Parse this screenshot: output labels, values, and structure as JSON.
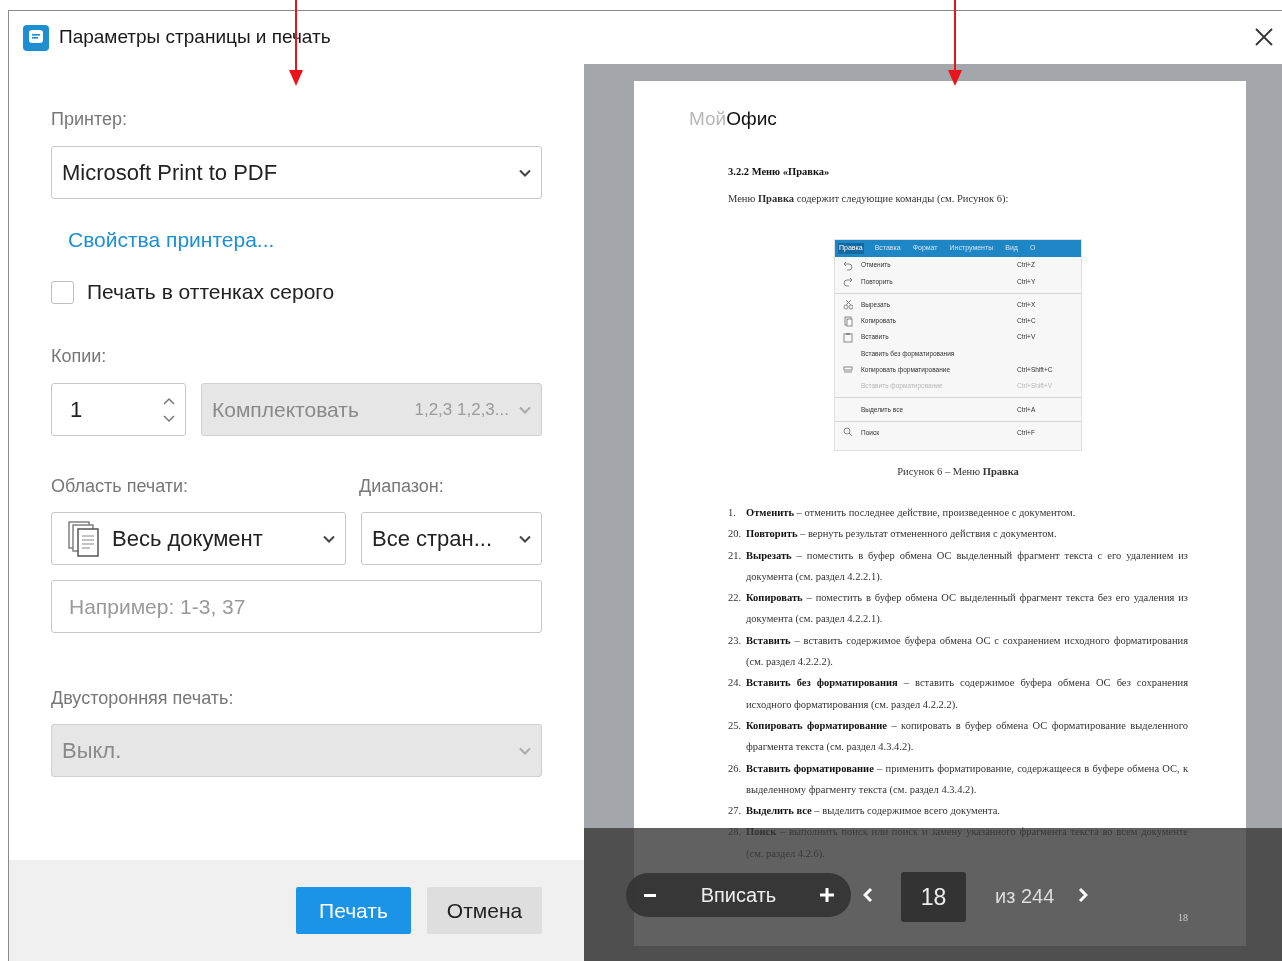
{
  "window": {
    "title": "Параметры страницы и печать"
  },
  "printer": {
    "label": "Принтер:",
    "value": "Microsoft Print to PDF"
  },
  "printer_properties_link": "Свойства принтера...",
  "grayscale": {
    "label": "Печать в оттенках серого",
    "checked": false
  },
  "copies": {
    "label": "Копии:",
    "value": "1"
  },
  "collate": {
    "value": "Комплектовать",
    "hint": "1,2,3 1,2,3...",
    "disabled": true
  },
  "print_area": {
    "label": "Область печати:",
    "value": "Весь документ"
  },
  "range": {
    "label": "Диапазон:",
    "value": "Все стран..."
  },
  "pages_field": {
    "placeholder": "Например: 1-3, 37"
  },
  "duplex": {
    "label": "Двусторонняя печать:",
    "value": "Выкл.",
    "disabled": true
  },
  "buttons": [
    {
      "label": "Печать",
      "kind": "primary"
    },
    {
      "label": "Отмена",
      "kind": "secondary"
    }
  ],
  "preview": {
    "document": {
      "logo": "Мой**Офис**",
      "heading": "3.2.2 Меню «Правка»",
      "intro": "Меню **Правка** содержит следующие команды (см. Рисунок 6):",
      "figure": {
        "menu_bar": [
          {
            "label": "Правка",
            "selected": true
          },
          {
            "label": "Вставка",
            "selected": false
          },
          {
            "label": "Формат",
            "selected": false
          },
          {
            "label": "Инструменты",
            "selected": false
          },
          {
            "label": "Вид",
            "selected": false
          },
          {
            "label": "О",
            "selected": false
          }
        ],
        "items": [
          {
            "label": "Отменить",
            "shortcut": "Ctrl+Z",
            "disabled": false,
            "divider_before": false
          },
          {
            "label": "Повторить",
            "shortcut": "Ctrl+Y",
            "disabled": false,
            "divider_before": false
          },
          {
            "label": "Вырезать",
            "shortcut": "Ctrl+X",
            "disabled": false,
            "divider_before": true
          },
          {
            "label": "Копировать",
            "shortcut": "Ctrl+C",
            "disabled": false,
            "divider_before": false
          },
          {
            "label": "Вставить",
            "shortcut": "Ctrl+V",
            "disabled": false,
            "divider_before": false
          },
          {
            "label": "Вставить без форматирования",
            "disabled": false,
            "divider_before": false
          },
          {
            "label": "Копировать форматирование",
            "shortcut": "Ctrl+Shift+C",
            "disabled": false,
            "divider_before": false
          },
          {
            "label": "Вставить форматирование",
            "shortcut": "Ctrl+Shift+V",
            "disabled": true,
            "divider_before": false
          },
          {
            "label": "Выделить все",
            "shortcut": "Ctrl+A",
            "disabled": false,
            "divider_before": true
          },
          {
            "label": "Поиск",
            "shortcut": "Ctrl+F",
            "disabled": false,
            "divider_before": true
          }
        ],
        "caption": "Рисунок 6 – Меню **Правка**"
      },
      "list": [
        {
          "number": "1.",
          "text": "**Отменить** – отменить последнее действие, произведенное с документом."
        },
        {
          "number": "20.",
          "text": "**Повторить** – вернуть результат отмененного действия с документом."
        },
        {
          "number": "21.",
          "text": "**Вырезать** – поместить в буфер обмена ОС выделенный фрагмент текста с его удалением из документа (см. раздел 4.2.2.1)."
        },
        {
          "number": "22.",
          "text": "**Копировать** – поместить в буфер обмена ОС выделенный фрагмент текста без его удаления из документа (см. раздел 4.2.2.1)."
        },
        {
          "number": "23.",
          "text": "**Вставить** – вставить содержимое буфера обмена ОС с сохранением исходного форматирования (см. раздел 4.2.2.2)."
        },
        {
          "number": "24.",
          "text": "**Вставить без форматирования** – вставить содержимое буфера обмена ОС без сохранения исходного форматирования (см. раздел 4.2.2.2)."
        },
        {
          "number": "25.",
          "text": "**Копировать форматирование** – копировать в буфер обмена ОС форматирование выделенного фрагмента текста (см. раздел 4.3.4.2)."
        },
        {
          "number": "26.",
          "text": "**Вставить форматирование** – применить форматирование, содержащееся в буфере обмена ОС, к выделенному фрагменту текста (см. раздел 4.3.4.2)."
        },
        {
          "number": "27.",
          "text": "**Выделить все** – выделить содержимое всего документа."
        },
        {
          "number": "28.",
          "text": "**Поиск** – выполнить поиск или поиск и замену указанного фрагмента текста во всем документе (см. раздел 4.2.6)."
        }
      ],
      "page_number": "18"
    },
    "toolbar": {
      "fit": "Вписать",
      "page": "18",
      "total": "из 244"
    }
  }
}
